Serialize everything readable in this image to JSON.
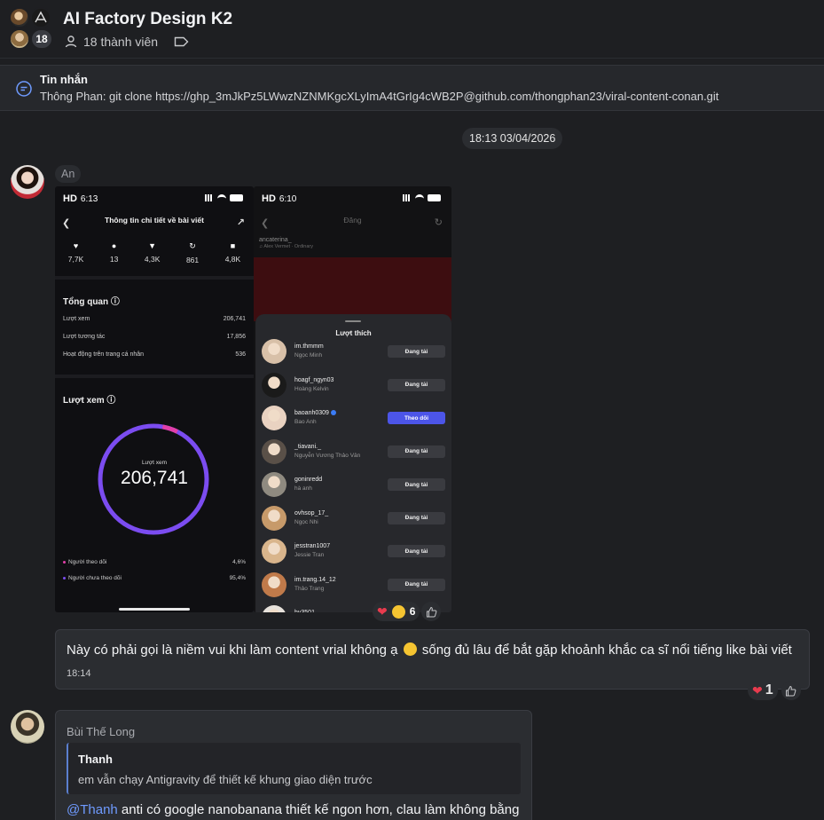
{
  "header": {
    "title": "AI Factory Design K2",
    "member_badge": "18",
    "members_label": "18 thành viên"
  },
  "pinned": {
    "title": "Tin nhắn",
    "text": "Thông Phan: git clone https://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@github.com/thongphan23/viral-content-conan.git"
  },
  "date_separator": "18:13 03/04/2026",
  "message1": {
    "sender": "An",
    "left_screenshot": {
      "hd": "HD",
      "time": "6:13",
      "nav_title": "Thông tin chi tiết về bài viết",
      "stats": [
        {
          "icon": "heart-icon",
          "glyph": "♥",
          "value": "7,7K"
        },
        {
          "icon": "comment-icon",
          "glyph": "●",
          "value": "13"
        },
        {
          "icon": "share-icon",
          "glyph": "▼",
          "value": "4,3K"
        },
        {
          "icon": "repost-icon",
          "glyph": "↻",
          "value": "861"
        },
        {
          "icon": "bookmark-icon",
          "glyph": "■",
          "value": "4,8K"
        }
      ],
      "overview_title": "Tổng quan",
      "overview_rows": [
        {
          "label": "Lượt xem",
          "value": "206,741"
        },
        {
          "label": "Lượt tương tác",
          "value": "17,856"
        },
        {
          "label": "Hoạt động trên trang cá nhân",
          "value": "536"
        }
      ],
      "views_title": "Lượt xem",
      "ring_label": "Lượt xem",
      "ring_value": "206,741",
      "ring_followers_share": 0.046,
      "legend": [
        {
          "label": "Người theo dõi",
          "value": "4,6%",
          "color": "#e23fa9"
        },
        {
          "label": "Người chưa theo dõi",
          "value": "95,4%",
          "color": "#7b4cf0"
        }
      ]
    },
    "right_screenshot": {
      "hd": "HD",
      "time": "6:10",
      "nav_title": "Đăng",
      "poster": "ancaterina_",
      "poster_sub": "♫ Alex Vermet · Ordinary",
      "sheet_title": "Lượt thích",
      "likes": [
        {
          "username": "im.thmmm",
          "name": "Ngọc Minh",
          "button": "Đang tải",
          "color": "#d8c0a8"
        },
        {
          "username": "hoagf_ngyn03",
          "name": "Hoàng Kelvin",
          "button": "Đang tải",
          "color": "#1a1a1a"
        },
        {
          "username": "baoanh0309",
          "name": "Bao Anh",
          "button": "Theo dõi",
          "follow": true,
          "verified": true,
          "color": "#e9d2c1"
        },
        {
          "username": "_tiavani._",
          "name": "Nguyễn Vương Thảo Vân",
          "button": "Đang tải",
          "color": "#5a5048"
        },
        {
          "username": "goninredd",
          "name": "hà anh",
          "button": "Đang tải",
          "color": "#8f8a80"
        },
        {
          "username": "ovhsop_17_",
          "name": "Ngọc Nhi",
          "button": "Đang tải",
          "color": "#c79a6a"
        },
        {
          "username": "jesstran1007",
          "name": "Jessie Tran",
          "button": "Đang tải",
          "color": "#d9b58c"
        },
        {
          "username": "im.trang.14_12",
          "name": "Thảo Trang",
          "button": "Đang tải",
          "color": "#c07a4a"
        },
        {
          "username": "hy3501",
          "name": "",
          "button": "",
          "color": "#e7e2dc"
        }
      ]
    },
    "reactions": {
      "count": "6"
    }
  },
  "message2": {
    "text_before": "Này có phải gọi là niềm vui khi làm content vrial không ạ",
    "text_after": "sống đủ lâu để bắt gặp khoảnh khắc ca sĩ nổi tiếng like bài viết",
    "time": "18:14",
    "reaction_count": "1"
  },
  "message3": {
    "sender": "Bùi Thế Long",
    "quote_name": "Thanh",
    "quote_text": "em vẫn chạy Antigravity để thiết kế khung giao diện trước",
    "mention": "@Thanh",
    "text": " anti có google nanobanana thiết kế ngon hơn, clau làm không bằng"
  },
  "colors": {
    "background": "#1e1f22",
    "bubble": "#2b2d31",
    "mention": "#6f9bff",
    "follow_button": "#4c55e8"
  }
}
